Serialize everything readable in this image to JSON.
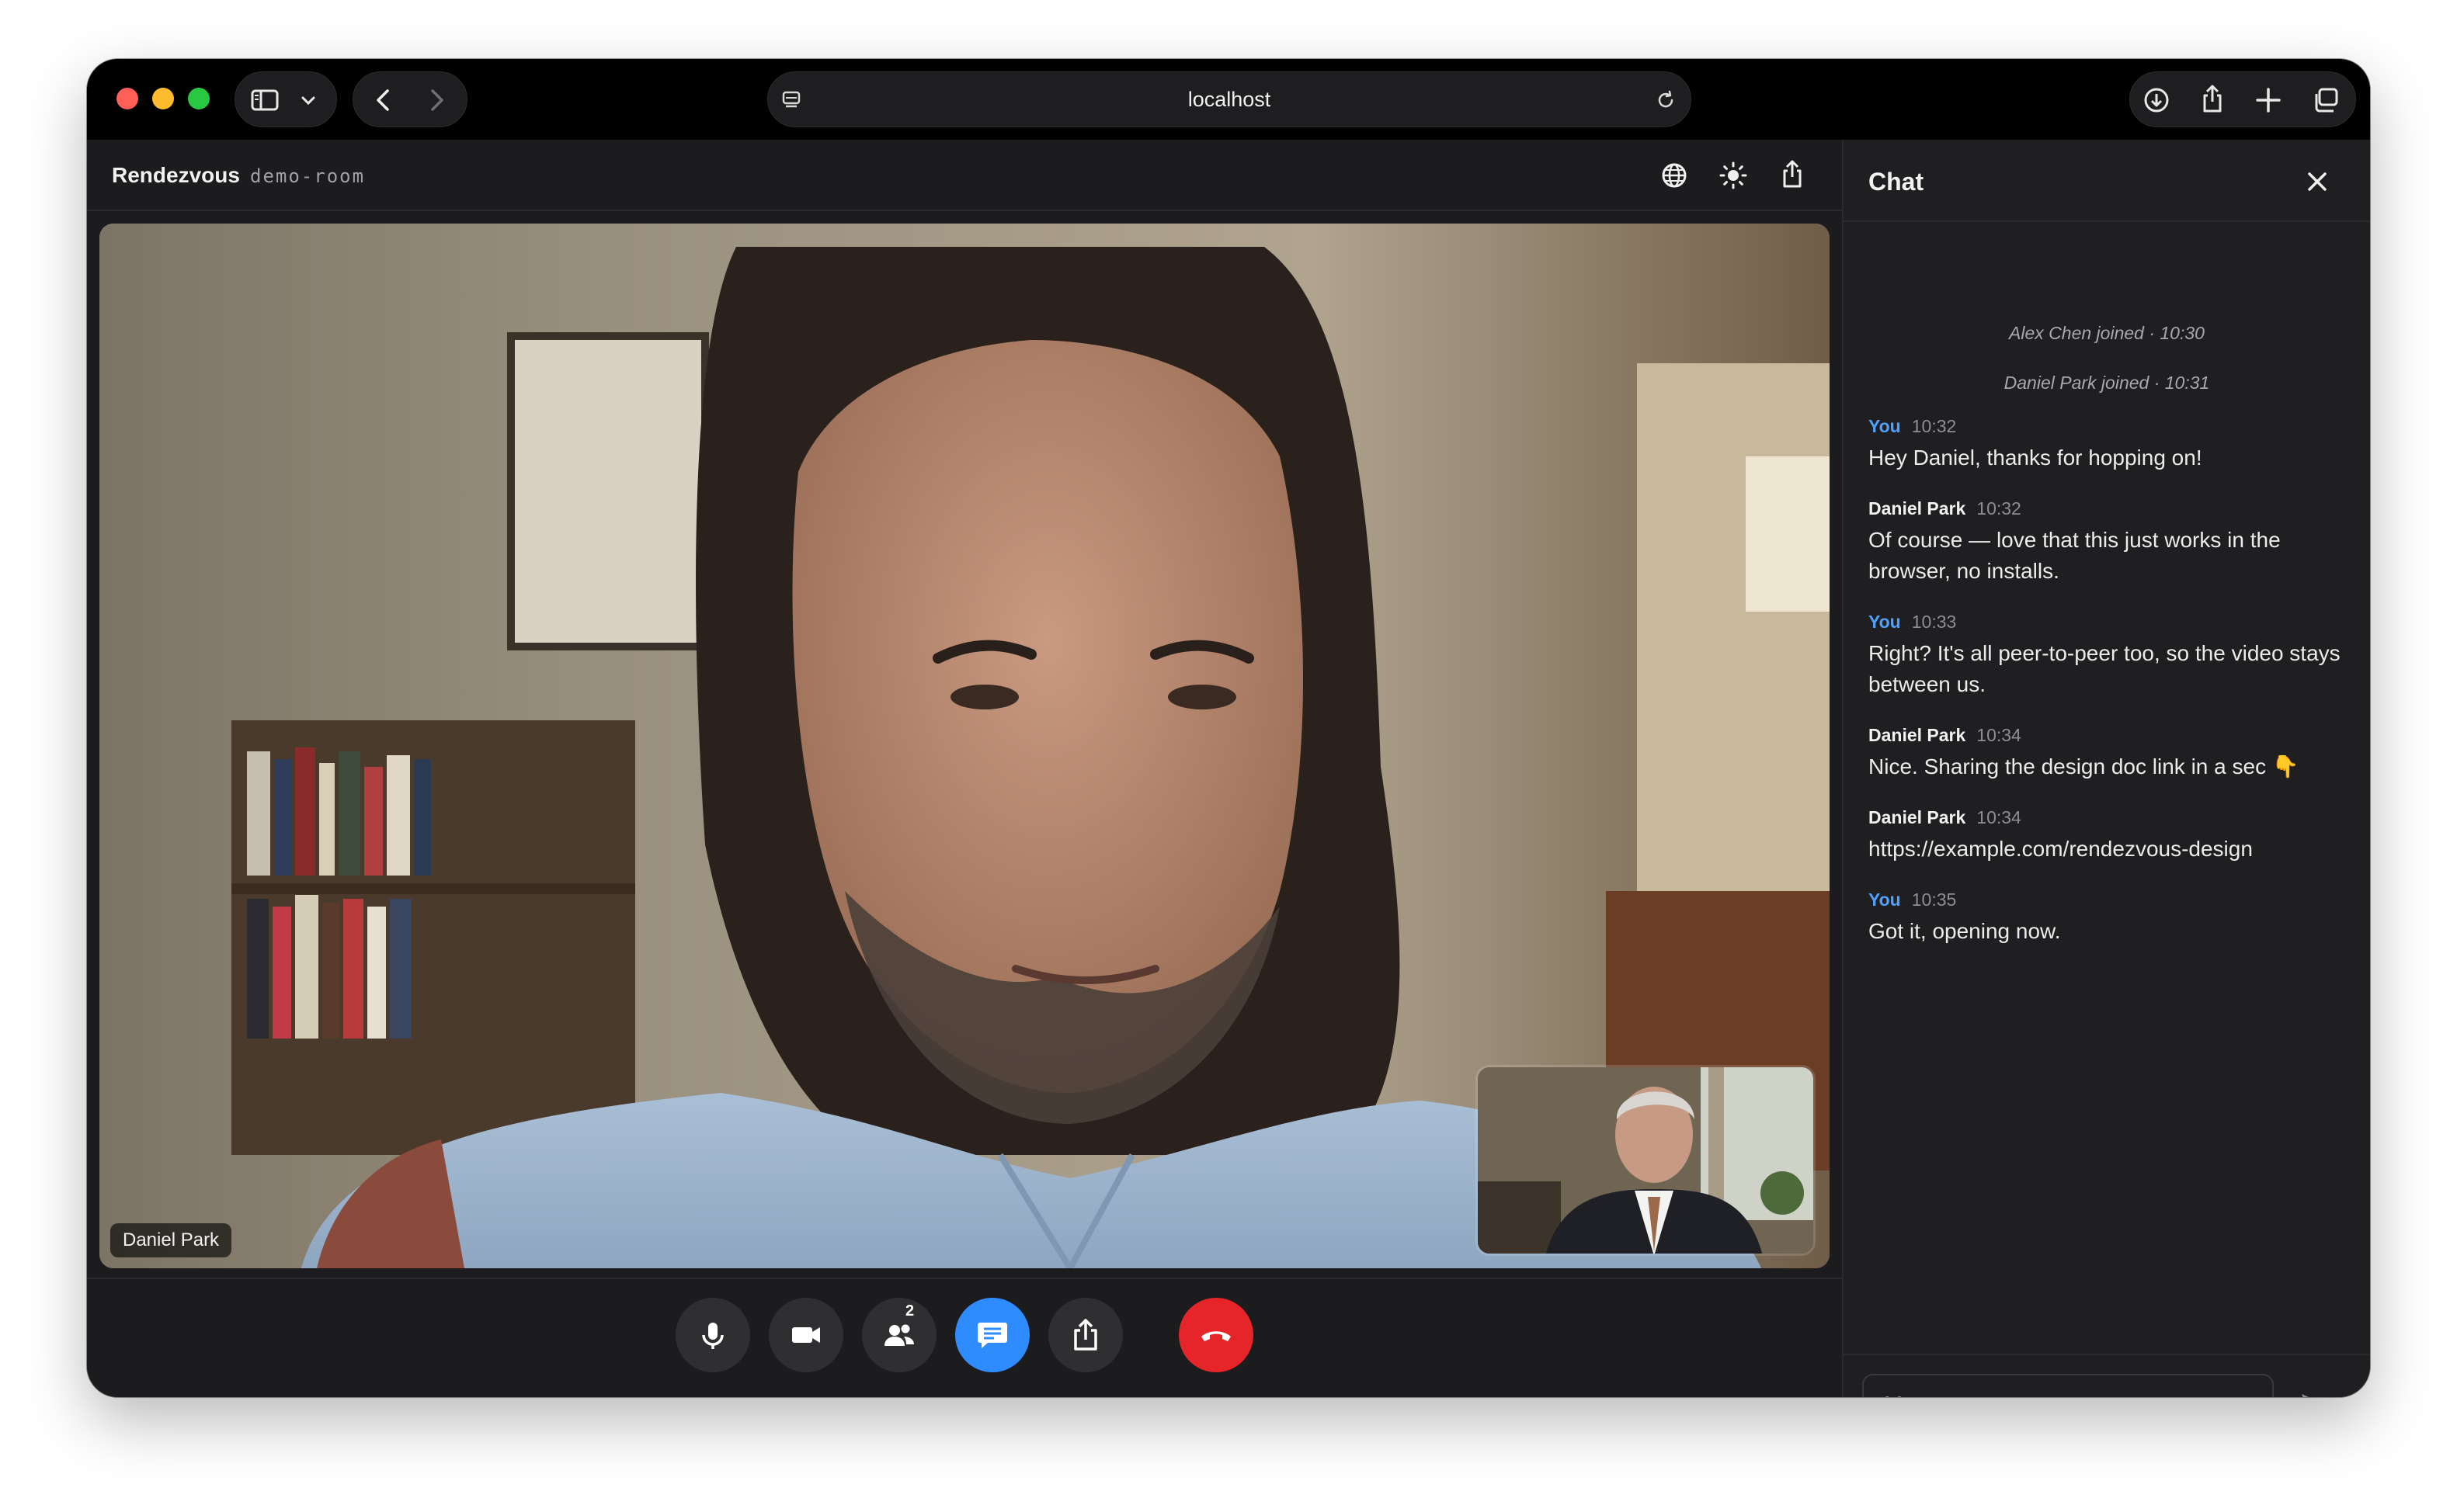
{
  "browser": {
    "address": "localhost"
  },
  "app": {
    "title": "Rendezvous",
    "room": "demo-room"
  },
  "video": {
    "main_participant": "Daniel Park"
  },
  "controls": {
    "participant_count": "2"
  },
  "chat": {
    "title": "Chat",
    "system_messages": [
      "Alex Chen joined · 10:30",
      "Daniel Park joined · 10:31"
    ],
    "messages": [
      {
        "author": "You",
        "time": "10:32",
        "text": "Hey Daniel, thanks for hopping on!"
      },
      {
        "author": "Daniel Park",
        "time": "10:32",
        "text": "Of course — love that this just works in the browser, no installs."
      },
      {
        "author": "You",
        "time": "10:33",
        "text": "Right? It's all peer-to-peer too, so the video stays between us."
      },
      {
        "author": "Daniel Park",
        "time": "10:34",
        "text": "Nice. Sharing the design doc link in a sec 👇"
      },
      {
        "author": "Daniel Park",
        "time": "10:34",
        "text": "https://example.com/rendezvous-design"
      },
      {
        "author": "You",
        "time": "10:35",
        "text": "Got it, opening now."
      }
    ],
    "input_placeholder": "Message..."
  },
  "colors": {
    "accent": "#2f8cff",
    "hangup": "#e5252a",
    "you_author": "#4ea1ff"
  },
  "icons": {
    "header": [
      "globe-icon",
      "brightness-icon",
      "share-icon"
    ],
    "controls": [
      "microphone-icon",
      "camera-icon",
      "participants-icon",
      "chat-icon",
      "share-screen-icon",
      "hang-up-icon"
    ]
  }
}
